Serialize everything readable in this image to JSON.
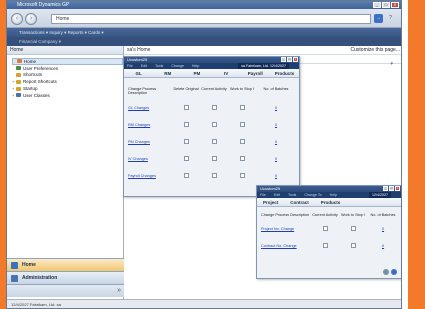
{
  "window": {
    "title": "Microsoft Dynamics GP",
    "minimize": "_",
    "maximize": "□",
    "close": "X"
  },
  "address": {
    "value": "Home"
  },
  "command_bar": {
    "items": "Transactions ▾   Inquiry ▾   Reports ▾   Cards ▾",
    "secondary": "Financial   Company ▾"
  },
  "nav_pane": {
    "title": "Home",
    "items": [
      {
        "label": "Home",
        "selected": true,
        "icon_color": "#e07d3a"
      },
      {
        "label": "User Preferences",
        "selected": false,
        "icon_color": "#4f8a3c"
      },
      {
        "label": "Shortcuts",
        "selected": false,
        "icon_color": "#d6a22a"
      },
      {
        "label": "Report Shortcuts",
        "selected": false,
        "icon_color": "#d6a22a",
        "expand": "+"
      },
      {
        "label": "Startup",
        "selected": false,
        "icon_color": "#d6a22a",
        "expand": "+"
      },
      {
        "label": "User Classes",
        "selected": false,
        "icon_color": "#4a6fb0",
        "expand": "+"
      }
    ],
    "workbars": [
      {
        "label": "Home",
        "active": true
      },
      {
        "label": "Administration",
        "active": false
      }
    ],
    "collapse_glyph": "»"
  },
  "main": {
    "title": "sa's Home",
    "customize_link": "Customize this page..."
  },
  "dialog1": {
    "title": "Ucustom25",
    "menu": [
      "File",
      "Edit",
      "Tools",
      "Change",
      "Help"
    ],
    "company": "sa  Fabrikam, Ltd.  12/4/2027",
    "tabs": [
      "GL",
      "RM",
      "PM",
      "IV",
      "Payroll",
      "Products"
    ],
    "headers": [
      "Change Process Description",
      "Delete Original",
      "Current Activity",
      "Work to Stop I",
      "No. of Batches"
    ],
    "rows": [
      {
        "desc": "GL Changes",
        "count": "0"
      },
      {
        "desc": "RM Changes",
        "count": "0"
      },
      {
        "desc": "PM Changes",
        "count": "0"
      },
      {
        "desc": "IV Changes",
        "count": "0"
      },
      {
        "desc": "Payroll Changes",
        "count": "0"
      }
    ]
  },
  "dialog2": {
    "title": "Ucustom25",
    "menu": [
      "File",
      "Edit",
      "Tools",
      "Change To",
      "Help"
    ],
    "company": "12/4/2027",
    "tabs": [
      "Project",
      "Contract",
      "Products"
    ],
    "headers": [
      "Change Process Description",
      "Current Activity",
      "Work to Stop I",
      "No. of Batches"
    ],
    "rows": [
      {
        "desc": "Project No. Change",
        "count": "0"
      },
      {
        "desc": "Contract No. Change",
        "count": "0"
      }
    ]
  },
  "status": {
    "text": "12/4/2027  Fabrikam, Ltd.  sa"
  },
  "colors": {
    "accent": "#f47a2b",
    "title_bar": "#3f6398",
    "link": "#1f3fb0"
  }
}
